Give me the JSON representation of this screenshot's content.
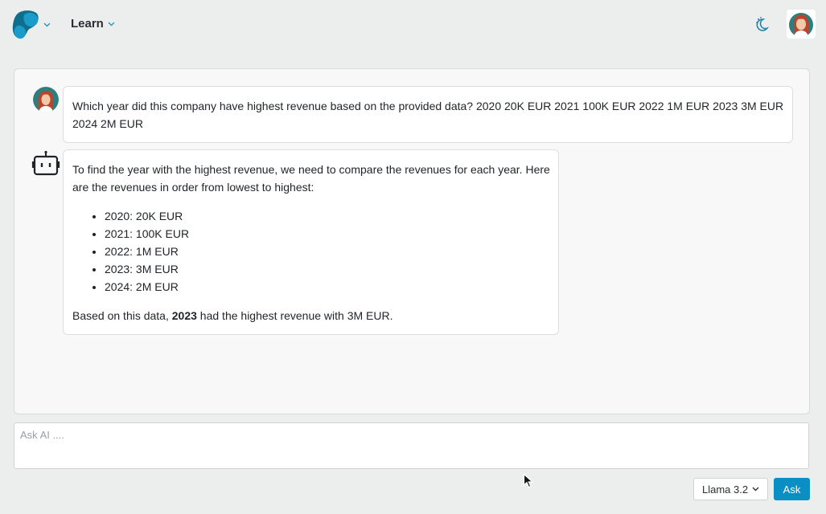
{
  "header": {
    "logo_icon": "brand-logo-icon",
    "nav_label": "Learn",
    "theme_icon": "moon-dots-icon"
  },
  "colors": {
    "accent": "#0a8fc4",
    "logo_dark": "#0e6e8c",
    "logo_light": "#1b9cc8",
    "background": "#eceeed",
    "panel": "#f8f8f8"
  },
  "chat": {
    "messages": [
      {
        "role": "user",
        "avatar_icon": "user-avatar",
        "text": "Which year did this company have highest revenue based on the provided data? 2020 20K EUR 2021 100K EUR 2022 1M EUR 2023 3M EUR 2024 2M EUR"
      },
      {
        "role": "assistant",
        "avatar_icon": "robot-icon",
        "intro": "To find the year with the highest revenue, we need to compare the revenues for each year. Here are the revenues in order from lowest to highest:",
        "items": [
          "2020: 20K EUR",
          "2021: 100K EUR",
          "2022: 1M EUR",
          "2023: 3M EUR",
          "2024: 2M EUR"
        ],
        "conclusion_prefix": "Based on this data, ",
        "conclusion_bold": "2023",
        "conclusion_suffix": " had the highest revenue with 3M EUR."
      }
    ]
  },
  "composer": {
    "placeholder": "Ask AI ....",
    "value": "",
    "model_selected": "Llama 3.2",
    "ask_label": "Ask"
  }
}
